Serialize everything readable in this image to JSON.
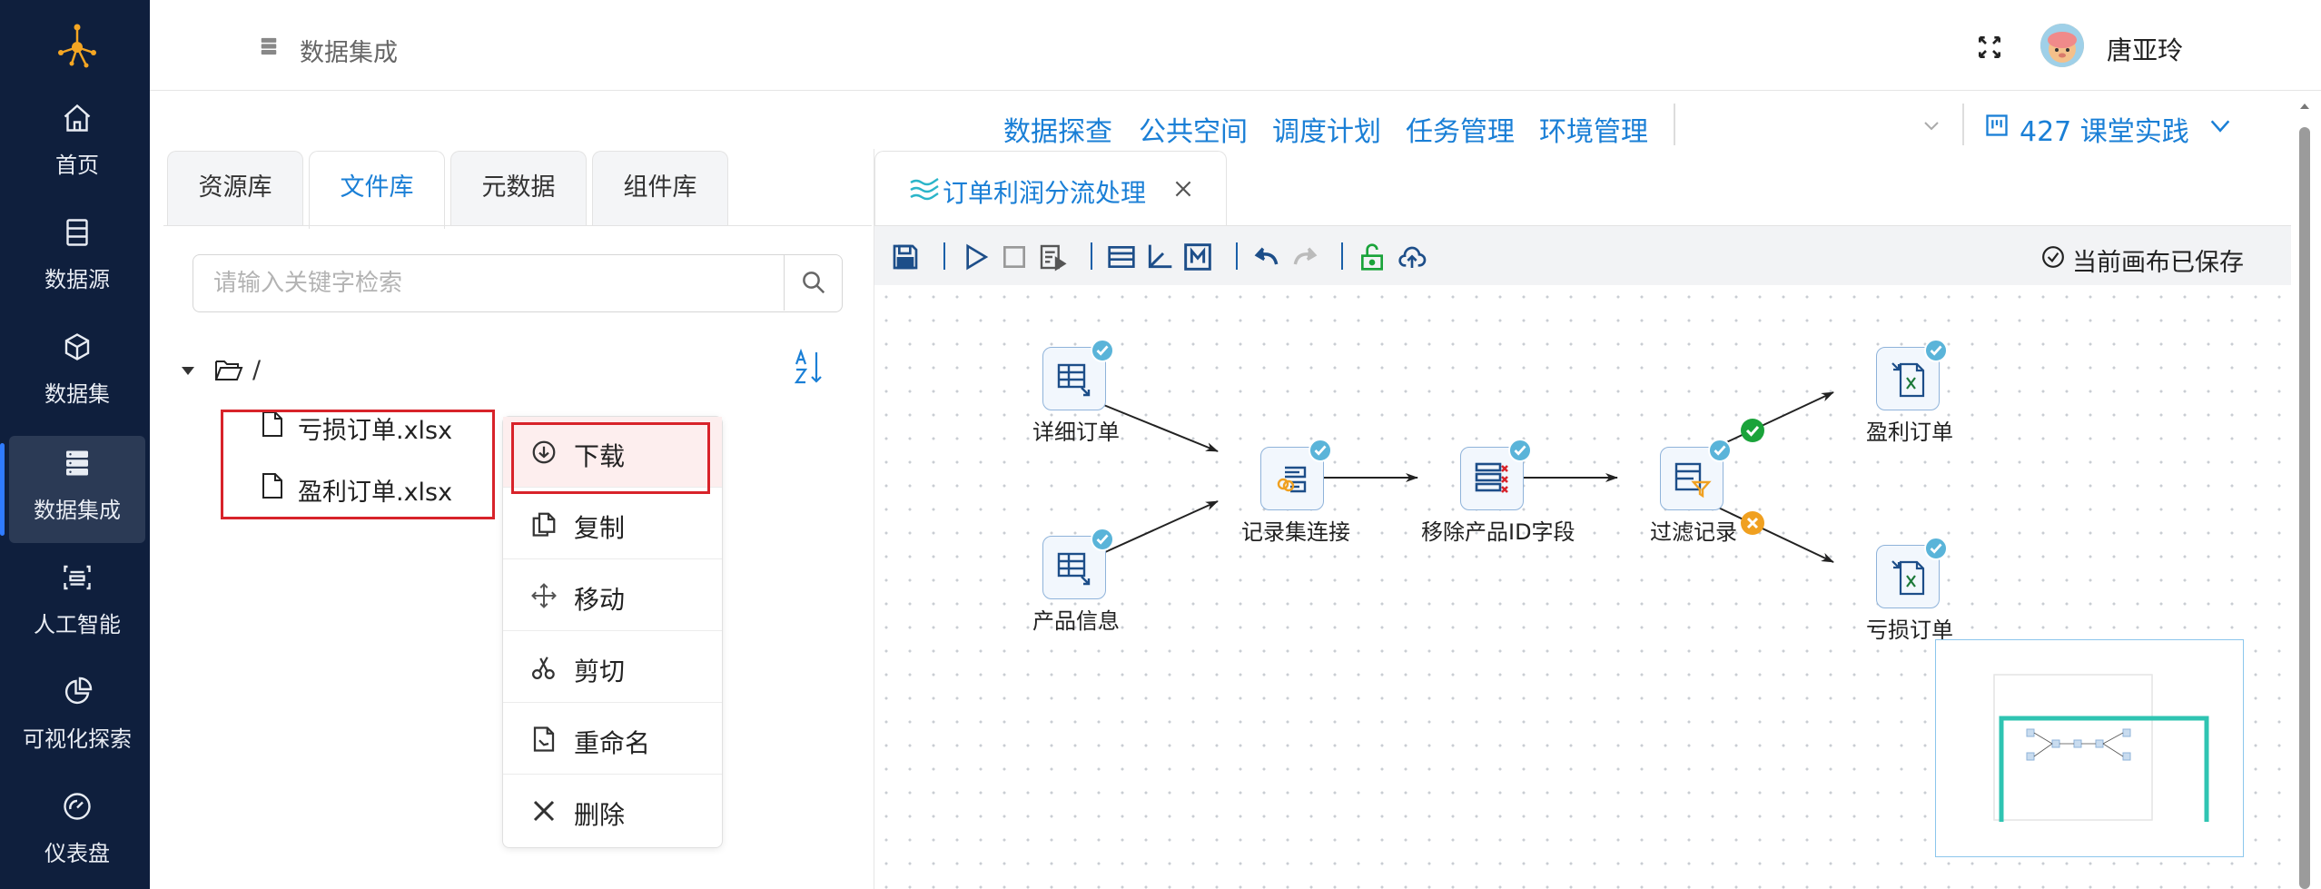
{
  "sidebar": {
    "items": [
      {
        "label": "首页",
        "icon": "home-icon"
      },
      {
        "label": "数据源",
        "icon": "database-icon"
      },
      {
        "label": "数据集",
        "icon": "cube-icon"
      },
      {
        "label": "数据集成",
        "icon": "server-icon",
        "active": true
      },
      {
        "label": "人工智能",
        "icon": "ai-icon"
      },
      {
        "label": "可视化探索",
        "icon": "pie-chart-icon"
      },
      {
        "label": "仪表盘",
        "icon": "gauge-icon"
      }
    ]
  },
  "header": {
    "breadcrumb": "数据集成",
    "user_name": "唐亚玲"
  },
  "topnav": {
    "links": [
      "数据探查",
      "公共空间",
      "调度计划",
      "任务管理",
      "环境管理"
    ],
    "project": "427 课堂实践"
  },
  "left_panel": {
    "tabs": [
      "资源库",
      "文件库",
      "元数据",
      "组件库"
    ],
    "active_tab": "文件库",
    "search_placeholder": "请输入关键字检索",
    "tree_root": "/",
    "files": [
      "亏损订单.xlsx",
      "盈利订单.xlsx"
    ]
  },
  "context_menu": {
    "items": [
      "下载",
      "复制",
      "移动",
      "剪切",
      "重命名",
      "删除"
    ]
  },
  "editor": {
    "tab_title": "订单利润分流处理",
    "save_status": "当前画布已保存",
    "nodes": {
      "detail_order": "详细订单",
      "product_info": "产品信息",
      "record_join": "记录集连接",
      "remove_field": "移除产品ID字段",
      "filter": "过滤记录",
      "profit_order": "盈利订单",
      "loss_order": "亏损订单"
    }
  },
  "colors": {
    "sidebar_bg": "#0f1f3d",
    "accent": "#1a7fd6",
    "highlight_red": "#d8232a",
    "success_green": "#1aa33a",
    "warning_orange": "#f0a020"
  }
}
